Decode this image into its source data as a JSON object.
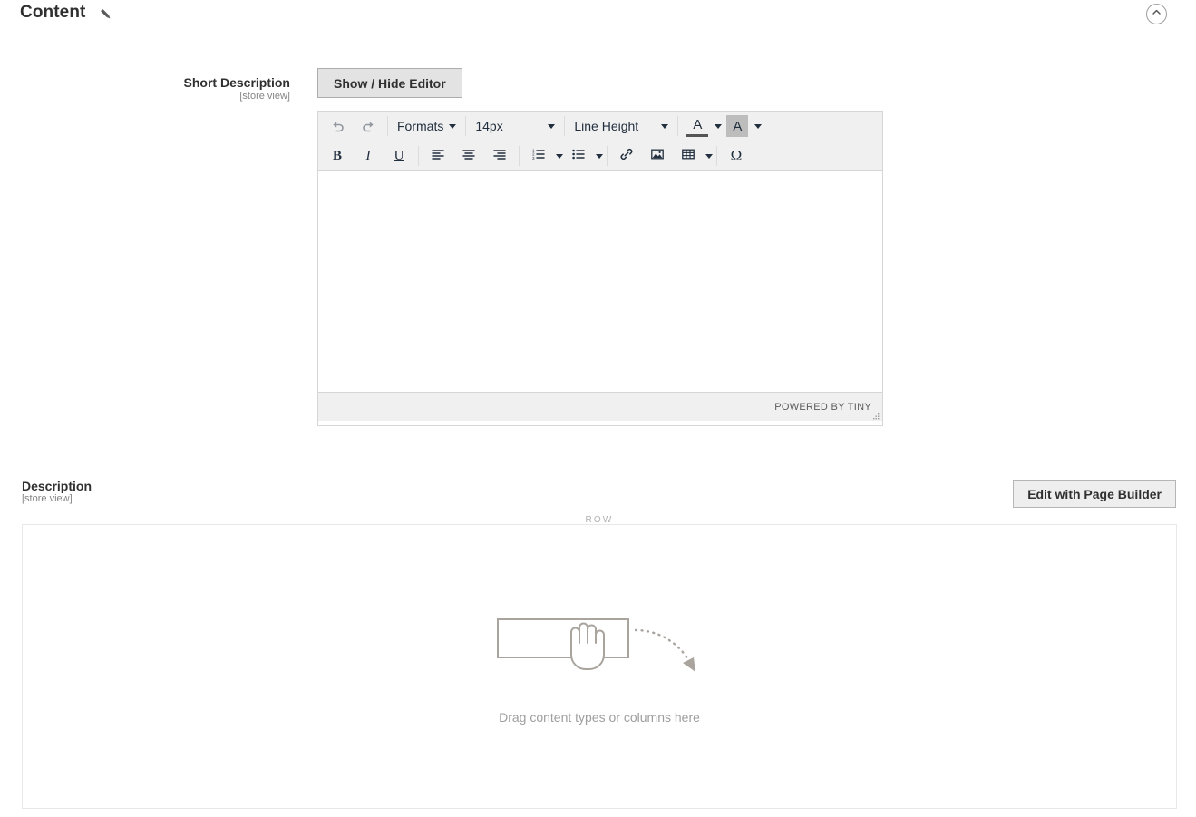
{
  "section": {
    "title": "Content",
    "edit_icon": "pencil-icon",
    "collapse_icon": "chevron-up-icon"
  },
  "short_description": {
    "label": "Short Description",
    "scope": "[store view]",
    "toggle_button": "Show / Hide Editor"
  },
  "editor": {
    "toolbar_row1": [
      {
        "name": "undo",
        "icon": "undo-arrow-icon",
        "type": "button",
        "disabled": true
      },
      {
        "name": "redo",
        "icon": "redo-arrow-icon",
        "type": "button",
        "disabled": true
      },
      {
        "name": "formats",
        "label": "Formats",
        "type": "select"
      },
      {
        "name": "fontsize",
        "label": "14px",
        "type": "select"
      },
      {
        "name": "lineheight",
        "label": "Line Height",
        "type": "select"
      },
      {
        "name": "forecolor",
        "label": "A",
        "icon": "text-color-icon",
        "type": "split"
      },
      {
        "name": "backcolor",
        "label": "A",
        "icon": "background-color-icon",
        "type": "split"
      }
    ],
    "toolbar_row2": [
      {
        "name": "bold",
        "label": "B",
        "icon": "bold-icon"
      },
      {
        "name": "italic",
        "label": "I",
        "icon": "italic-icon"
      },
      {
        "name": "underline",
        "label": "U",
        "icon": "underline-icon"
      },
      {
        "name": "alignleft",
        "icon": "align-left-icon"
      },
      {
        "name": "aligncenter",
        "icon": "align-center-icon"
      },
      {
        "name": "alignright",
        "icon": "align-right-icon"
      },
      {
        "name": "numlist",
        "icon": "numbered-list-icon"
      },
      {
        "name": "bullist",
        "icon": "bullet-list-icon"
      },
      {
        "name": "link",
        "icon": "link-icon"
      },
      {
        "name": "image",
        "icon": "image-icon"
      },
      {
        "name": "table",
        "icon": "table-icon"
      },
      {
        "name": "charmap",
        "label": "Ω",
        "icon": "special-character-icon"
      }
    ],
    "content": "",
    "status_bar": "POWERED BY TINY",
    "resize_handle": "resize-grip-icon"
  },
  "description": {
    "label": "Description",
    "scope": "[store view]",
    "page_builder_button": "Edit with Page Builder",
    "row_label": "ROW",
    "dropzone_caption": "Drag content types or columns here",
    "dropzone_illustration": "drag-hand-icon"
  },
  "colors": {
    "text": "#303030",
    "muted": "#858585",
    "placeholder": "#9e9e9e",
    "button_bg": "#e3e3e3",
    "toolbar_bg": "#f0f0f0",
    "border": "#d6d6d6",
    "divider": "#d8d8d8"
  }
}
